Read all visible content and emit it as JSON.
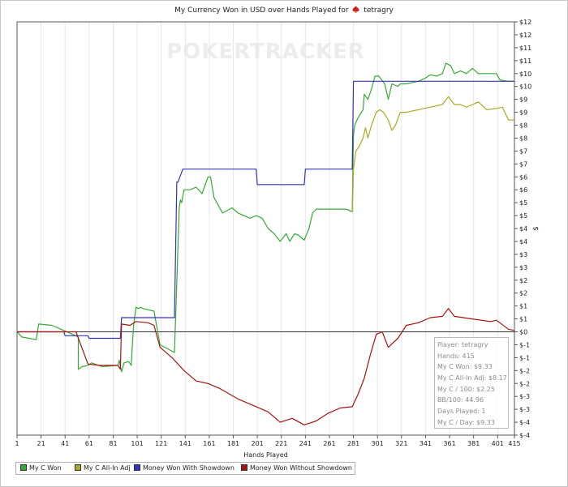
{
  "title": "My Currency Won in USD over Hands Played for",
  "player_name": "tetragry",
  "watermark": "POKERTRACKER",
  "legend": [
    {
      "label": "My C Won",
      "color": "#33aa33"
    },
    {
      "label": "My C All-In Adj",
      "color": "#aaaa22"
    },
    {
      "label": "Money Won With Showdown",
      "color": "#3333bb"
    },
    {
      "label": "Money Won Without Showdown",
      "color": "#aa1111"
    }
  ],
  "stats": {
    "player": "Player: tetragry",
    "hands": "Hands: 415",
    "won": "My C Won: $9.33",
    "allin": "My C All-In Adj: $8.17",
    "per100": "My C / 100: $2.25",
    "bb100": "BB/100: 44.96",
    "days": "Days Played: 1",
    "perday": "My C / Day: $9.33"
  },
  "chart_data": {
    "type": "line",
    "title": "My Currency Won in USD over Hands Played for tetragry",
    "xlabel": "Hands Played",
    "ylabel": "$",
    "xlim": [
      1,
      415
    ],
    "ylim": [
      -4,
      12
    ],
    "x_ticks": [
      1,
      21,
      41,
      61,
      81,
      101,
      121,
      141,
      161,
      181,
      201,
      221,
      241,
      261,
      281,
      301,
      321,
      341,
      361,
      381,
      401,
      415
    ],
    "y_ticks": [
      -4,
      -3.5,
      -3,
      -2.5,
      -2,
      -1.5,
      -1,
      -0.5,
      0,
      0.5,
      1,
      1.5,
      2,
      2.5,
      3,
      3.5,
      4,
      4.5,
      5,
      5.5,
      6,
      6.5,
      7,
      7.5,
      8,
      8.5,
      9,
      9.5,
      10,
      10.5,
      11,
      11.5,
      12
    ],
    "y_tick_labels": [
      "$-4",
      "$-4",
      "$-3",
      "$-3",
      "$-2",
      "$-2",
      "$-1",
      "$-1",
      "$0",
      "$1",
      "$1",
      "$2",
      "$2",
      "$3",
      "$3",
      "$4",
      "$4",
      "$5",
      "$5",
      "$6",
      "$6",
      "$7",
      "$7",
      "$8",
      "$8",
      "$9",
      "$9",
      "$10",
      "$10",
      "$11",
      "$11",
      "$12",
      "$12"
    ],
    "series": [
      {
        "name": "My C Won",
        "color": "#33aa33",
        "x": [
          1,
          3,
          5,
          17,
          19,
          30,
          45,
          52,
          52,
          55,
          60,
          63,
          72,
          85,
          86,
          88,
          90,
          94,
          96,
          98,
          100,
          102,
          104,
          106,
          115,
          120,
          132,
          136,
          137,
          138,
          140,
          145,
          150,
          155,
          160,
          162,
          165,
          172,
          180,
          185,
          195,
          200,
          205,
          210,
          215,
          220,
          225,
          228,
          232,
          235,
          240,
          244,
          247,
          250,
          262,
          275,
          280,
          281,
          282,
          285,
          289,
          290,
          293,
          296,
          299,
          302,
          307,
          310,
          313,
          318,
          320,
          325,
          335,
          340,
          345,
          350,
          355,
          358,
          362,
          365,
          370,
          375,
          380,
          385,
          390,
          396,
          400,
          403,
          410,
          415
        ],
        "y": [
          0.02,
          -0.1,
          -0.2,
          -0.3,
          0.3,
          0.25,
          -0.05,
          -0.2,
          -1.45,
          -1.35,
          -1.3,
          -1.2,
          -1.35,
          -1.3,
          -1.1,
          -1.55,
          -1.2,
          -1.15,
          -1.3,
          0.25,
          0.95,
          0.9,
          0.95,
          0.9,
          0.8,
          -0.5,
          -0.8,
          4.8,
          5.1,
          5.0,
          5.5,
          5.5,
          5.6,
          5.35,
          6.0,
          6.0,
          5.2,
          4.6,
          4.8,
          4.6,
          4.4,
          4.5,
          4.4,
          4.0,
          3.8,
          3.5,
          3.8,
          3.5,
          3.8,
          3.75,
          3.55,
          4.0,
          4.6,
          4.75,
          4.75,
          4.75,
          4.65,
          7.6,
          8.0,
          8.3,
          8.6,
          9.2,
          9.0,
          9.4,
          9.9,
          9.9,
          9.6,
          9.0,
          9.6,
          9.5,
          9.6,
          9.6,
          9.7,
          9.8,
          9.95,
          9.9,
          10.0,
          10.4,
          10.3,
          10.0,
          10.1,
          10.0,
          10.2,
          10.0,
          10.0,
          10.0,
          10.0,
          9.75,
          9.7,
          9.7
        ]
      },
      {
        "name": "My C All-In Adj",
        "color": "#aaaa22",
        "x": [
          280,
          281,
          283,
          286,
          289,
          291,
          293,
          296,
          300,
          303,
          306,
          310,
          313,
          316,
          320,
          325,
          335,
          345,
          355,
          360,
          365,
          370,
          375,
          385,
          392,
          400,
          405,
          410,
          415
        ],
        "y": [
          4.65,
          6.3,
          7.0,
          7.2,
          7.5,
          7.9,
          7.5,
          8.0,
          8.5,
          8.6,
          8.5,
          8.2,
          7.8,
          8.0,
          8.5,
          8.5,
          8.6,
          8.7,
          8.8,
          9.1,
          8.8,
          8.8,
          8.7,
          8.9,
          8.6,
          8.65,
          8.7,
          8.2,
          8.2
        ]
      },
      {
        "name": "Money Won With Showdown",
        "color": "#3333bb",
        "x": [
          1,
          40,
          41,
          60,
          61,
          87,
          88,
          125,
          132,
          134,
          135,
          139,
          140,
          200,
          201,
          240,
          241,
          278,
          280,
          281,
          415
        ],
        "y": [
          0.0,
          0.0,
          -0.15,
          -0.15,
          -0.25,
          -0.25,
          0.55,
          0.55,
          0.55,
          5.8,
          5.8,
          6.3,
          6.3,
          6.3,
          5.7,
          5.7,
          6.3,
          6.3,
          6.3,
          9.7,
          9.7
        ]
      },
      {
        "name": "Money Won Without Showdown",
        "color": "#aa1111",
        "x": [
          1,
          50,
          60,
          70,
          85,
          87,
          88,
          95,
          100,
          110,
          115,
          120,
          130,
          140,
          150,
          160,
          170,
          185,
          200,
          210,
          220,
          230,
          240,
          250,
          260,
          270,
          280,
          285,
          290,
          295,
          300,
          305,
          310,
          318,
          325,
          335,
          345,
          355,
          360,
          365,
          380,
          395,
          400,
          410,
          415
        ],
        "y": [
          0.0,
          0.0,
          -1.25,
          -1.3,
          -1.3,
          -1.45,
          0.3,
          0.25,
          0.4,
          0.35,
          0.25,
          -0.6,
          -1.0,
          -1.5,
          -1.9,
          -2.0,
          -2.2,
          -2.6,
          -2.9,
          -3.1,
          -3.5,
          -3.35,
          -3.6,
          -3.45,
          -3.15,
          -2.95,
          -2.9,
          -2.4,
          -1.8,
          -0.9,
          -0.1,
          0.0,
          -0.6,
          -0.25,
          0.25,
          0.35,
          0.55,
          0.6,
          0.9,
          0.6,
          0.5,
          0.4,
          0.45,
          0.1,
          0.05
        ]
      }
    ],
    "grid": "vertical only",
    "legend_position": "bottom-left"
  }
}
